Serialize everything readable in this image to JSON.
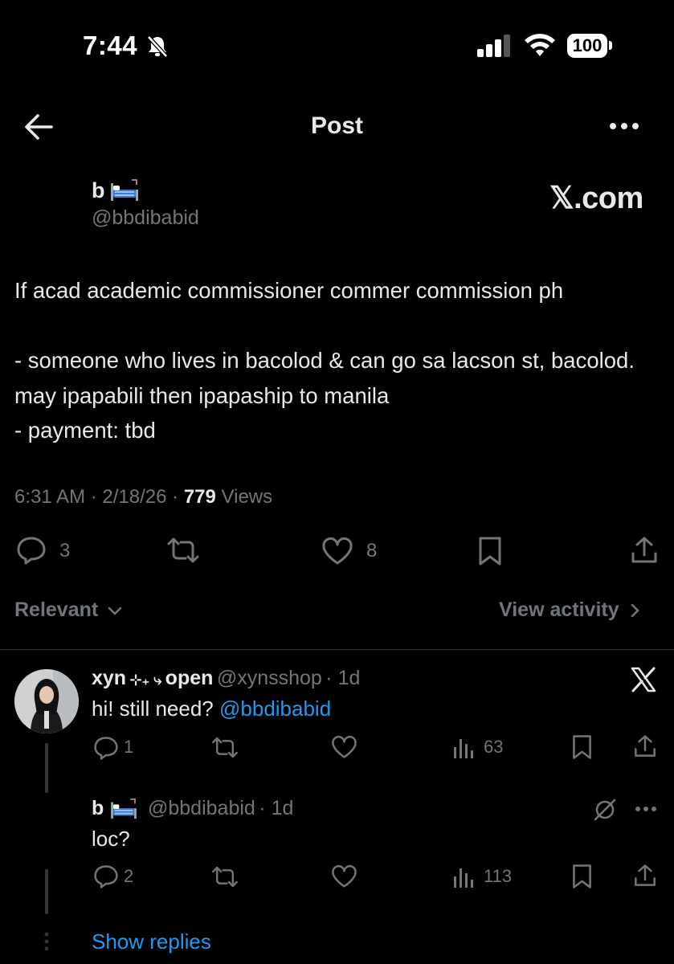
{
  "status_bar": {
    "time": "7:44",
    "battery": "100"
  },
  "nav": {
    "title": "Post"
  },
  "post": {
    "author_name": "b",
    "author_handle": "@bbdibabid",
    "watermark": "𝕏.com",
    "lines": [
      "If acad academic commissioner commer commission ph",
      "",
      "- someone who lives in bacolod & can go sa lacson st, bacolod. may ipapabili then ipapaship to manila",
      "- payment: tbd"
    ],
    "time": "6:31 AM",
    "date": "2/18/26",
    "views_count": "779",
    "views_label": "Views",
    "replies": "3",
    "likes": "8"
  },
  "sort": {
    "label": "Relevant",
    "view_activity": "View activity"
  },
  "replies": [
    {
      "name": "xyn",
      "name_deco": "⊹₊ ⤷",
      "name_suffix": "open",
      "handle": "@xynsshop",
      "age": "1d",
      "text": "hi! still need?",
      "mention": "@bbdibabid",
      "replies": "1",
      "views": "63"
    },
    {
      "name": "b",
      "handle": "@bbdibabid",
      "age": "1d",
      "text": "loc?",
      "replies": "2",
      "views": "113"
    }
  ],
  "show_replies": "Show replies",
  "colors": {
    "background": "#000000",
    "text": "#e7e9ea",
    "muted": "#71767b",
    "accent": "#1d9bf0"
  }
}
